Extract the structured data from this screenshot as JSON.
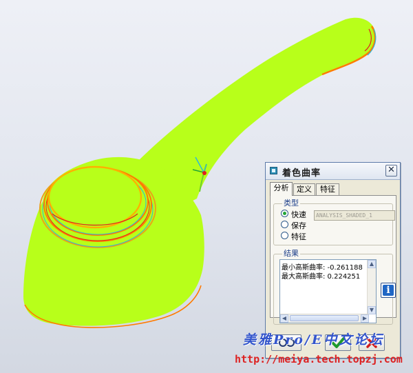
{
  "viewport": {
    "background_top": "#eef0f6",
    "background_bottom": "#d3d8e2",
    "model_fill": "#b8ff1a",
    "highlight_orange": "#ff7b00",
    "highlight_red": "#e01f1f",
    "highlight_cyan": "#2fb7d8",
    "coordinate_system": "csys-axes-icon"
  },
  "dialog": {
    "title": "着色曲率",
    "title_icon": "dialog-app-icon",
    "close_symbol": "✕",
    "tabs": [
      {
        "label": "分析",
        "active": true
      },
      {
        "label": "定义",
        "active": false
      },
      {
        "label": "特征",
        "active": false
      }
    ],
    "type_group": {
      "label": "类型",
      "options": [
        {
          "label": "快速",
          "checked": true
        },
        {
          "label": "保存",
          "checked": false
        },
        {
          "label": "特征",
          "checked": false
        }
      ],
      "name_value": "ANALYSIS_SHADED_1"
    },
    "results_group": {
      "label": "结果",
      "lines": [
        "最小高斯曲率: -0.261188",
        "最大高斯曲率: 0.224251"
      ],
      "scroll_up": "▲",
      "scroll_down": "▼",
      "scroll_left": "◀",
      "scroll_right": "▶",
      "info_symbol": "i"
    },
    "buttons": [
      {
        "name": "preview-button",
        "icon": "preview-glasses-icon"
      },
      {
        "name": "ok-button",
        "icon": "green-check-icon"
      },
      {
        "name": "cancel-button",
        "icon": "red-x-icon"
      }
    ]
  },
  "watermark": {
    "line1": "美雅Pro/E中文论坛",
    "url": "http://meiya.tech.topzj.com"
  }
}
